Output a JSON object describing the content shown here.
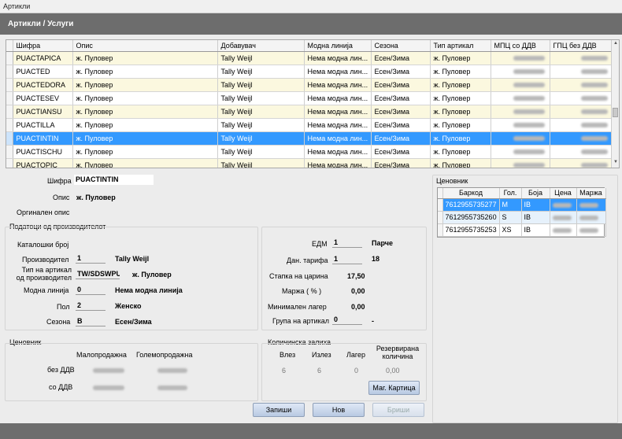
{
  "window": {
    "title": "Артикли"
  },
  "header": {
    "title": "Артикли / Услуги"
  },
  "grid": {
    "columns": [
      "Шифра",
      "Опис",
      "Добавувач",
      "Модна линија",
      "Сезона",
      "Тип артикал",
      "МПЦ со ДДВ",
      "ГПЦ без ДДВ"
    ],
    "rows": [
      [
        "PUACTAPICA",
        "ж. Пуловер",
        "Tally Weijl",
        "Нема модна лин...",
        "Есен/Зима",
        "ж. Пуловер"
      ],
      [
        "PUACTED",
        "ж. Пуловер",
        "Tally Weijl",
        "Нема модна лин...",
        "Есен/Зима",
        "ж. Пуловер"
      ],
      [
        "PUACTEDORA",
        "ж. Пуловер",
        "Tally Weijl",
        "Нема модна лин...",
        "Есен/Зима",
        "ж. Пуловер"
      ],
      [
        "PUACTESEV",
        "ж. Пуловер",
        "Tally Weijl",
        "Нема модна лин...",
        "Есен/Зима",
        "ж. Пуловер"
      ],
      [
        "PUACTIANSU",
        "ж. Пуловер",
        "Tally Weijl",
        "Нема модна лин...",
        "Есен/Зима",
        "ж. Пуловер"
      ],
      [
        "PUACTILLA",
        "ж. Пуловер",
        "Tally Weijl",
        "Нема модна лин...",
        "Есен/Зима",
        "ж. Пуловер"
      ],
      [
        "PUACTINTIN",
        "ж. Пуловер",
        "Tally Weijl",
        "Нема модна лин...",
        "Есен/Зима",
        "ж. Пуловер"
      ],
      [
        "PUACTISCHU",
        "ж. Пуловер",
        "Tally Weijl",
        "Нема модна лин...",
        "Есен/Зима",
        "ж. Пуловер"
      ],
      [
        "PUACTOPIC",
        "ж. Пуловер",
        "Tally Weijl",
        "Нема модна лин...",
        "Есен/Зима",
        "ж. Пуловер"
      ]
    ],
    "selected_index": 6
  },
  "detail": {
    "sifra_label": "Шифра",
    "sifra_value": "PUACTINTIN",
    "opis_label": "Опис",
    "opis_value": "ж. Пуловер",
    "orig_opis_label": "Оргинален опис"
  },
  "producer": {
    "title": "Податоци од производителот",
    "catalog_label": "Каталошки број",
    "producer_label": "Производител",
    "producer_code": "1",
    "producer_name": "Tally Weijl",
    "type_label": "Тип на артикал од производител",
    "type_code": "TW/SDSWPU",
    "type_name": "ж. Пуловер",
    "line_label": "Модна линија",
    "line_code": "0",
    "line_name": "Нема модна линија",
    "gender_label": "Пол",
    "gender_code": "2",
    "gender_name": "Женско",
    "season_label": "Сезона",
    "season_code": "B",
    "season_name": "Есен/Зима"
  },
  "tariff": {
    "edm_label": "ЕДМ",
    "edm_code": "1",
    "edm_name": "Парче",
    "tax_label": "Дан. тарифа",
    "tax_code": "1",
    "tax_value": "18",
    "customs_label": "Стапка на царина",
    "customs_value": "17,50",
    "margin_label": "Маржа ( % )",
    "margin_value": "0,00",
    "minstock_label": "Минимален лагер",
    "minstock_value": "0,00",
    "group_label": "Група на артикал",
    "group_code": "0",
    "group_name": "-"
  },
  "pricelist_small": {
    "title": "Ценовник",
    "retail_label": "Малопродажна",
    "wholesale_label": "Големопродажна",
    "no_vat_label": "без ДДВ",
    "with_vat_label": "со ДДВ"
  },
  "stock": {
    "title": "Количинска залиха",
    "in_label": "Влез",
    "out_label": "Излез",
    "stock_label": "Лагер",
    "reserved_label": "Резервирана количина",
    "in_value": "6",
    "out_value": "6",
    "stock_value": "0",
    "reserved_value": "0,00",
    "card_button": "Маг. Картица"
  },
  "buttons": {
    "save": "Запиши",
    "new": "Нов",
    "delete": "Бриши"
  },
  "pricelist": {
    "title": "Ценовник",
    "columns": [
      "Баркод",
      "Гол.",
      "Боја",
      "Цена",
      "Маржа"
    ],
    "rows": [
      [
        "7612955735277",
        "M",
        "IB"
      ],
      [
        "7612955735260",
        "S",
        "IB"
      ],
      [
        "7612955735253",
        "XS",
        "IB"
      ]
    ]
  }
}
